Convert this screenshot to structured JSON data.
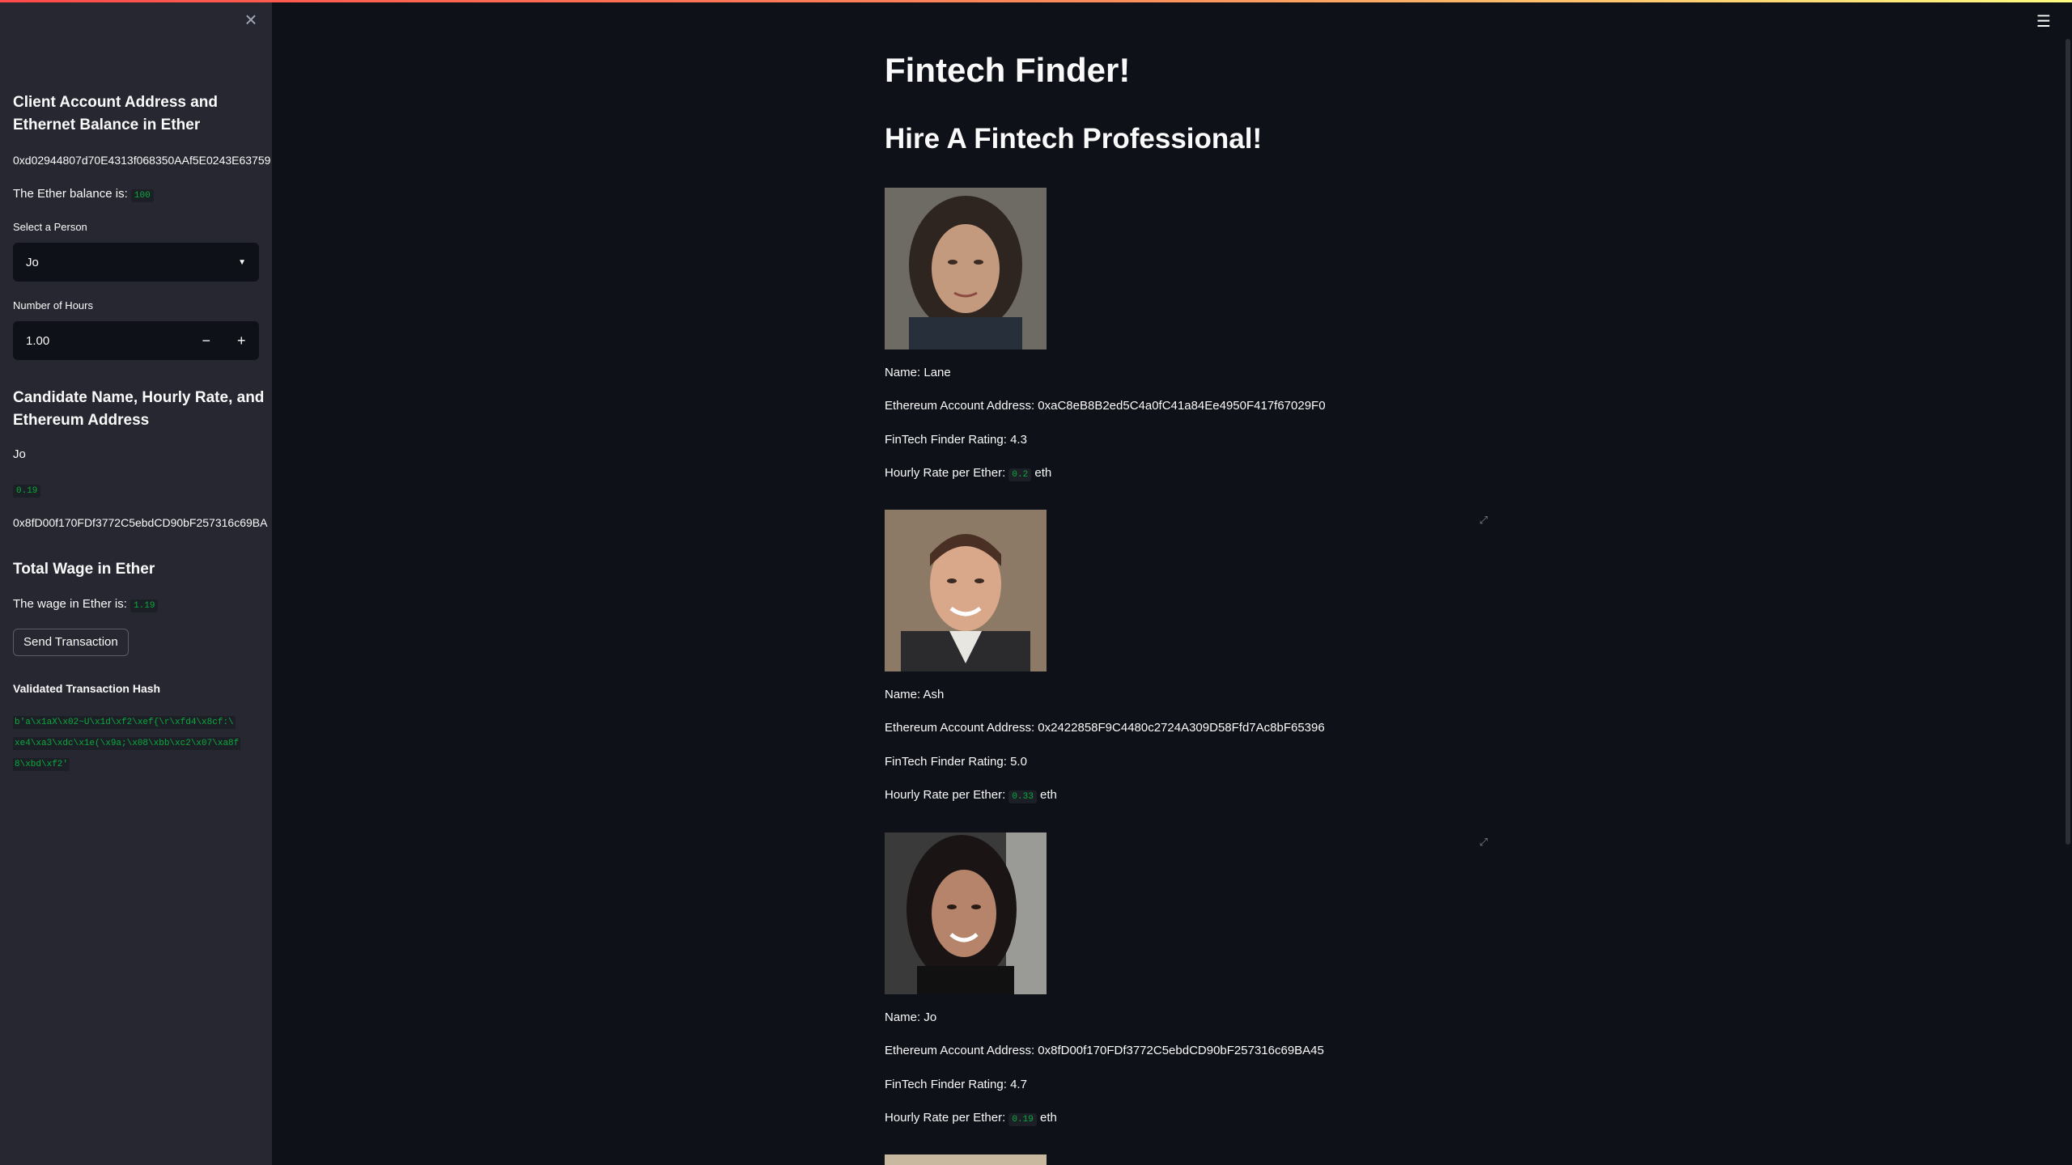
{
  "sidebar": {
    "close_icon": "×",
    "account_heading_line1": "Client Account Address and",
    "account_heading_line2": "Ethernet Balance in Ether",
    "account_address": "0xd02944807d70E4313f068350AAf5E0243E63759",
    "balance_label": "The Ether balance is:",
    "balance_value": "100",
    "select_label": "Select a Person",
    "select_value": "Jo",
    "hours_label": "Number of Hours",
    "hours_value": "1.00",
    "minus": "−",
    "plus": "+",
    "candidate_heading_line1": "Candidate Name, Hourly Rate, and",
    "candidate_heading_line2": "Ethereum Address",
    "candidate_name": "Jo",
    "candidate_rate": "0.19",
    "candidate_address": "0x8fD00f170FDf3772C5ebdCD90bF257316c69BA",
    "wage_heading": "Total Wage in Ether",
    "wage_label": "The wage in Ether is:",
    "wage_value": "1.19",
    "send_button": "Send Transaction",
    "hash_heading": "Validated Transaction Hash",
    "hash_line1": "b'a\\x1aX\\x02~U\\x1d\\xf2\\xef{\\r\\xfd4\\x8cf:\\",
    "hash_line2": "xe4\\xa3\\xdc\\x1e(\\x9a;\\x08\\xbb\\xc2\\x07\\xa8f",
    "hash_line3": "8\\xbd\\xf2'"
  },
  "main": {
    "hamburger_icon": "☰",
    "title": "Fintech Finder!",
    "subtitle": "Hire A Fintech Professional!",
    "candidates": [
      {
        "name": "Name: Lane",
        "address": "Ethereum Account Address: 0xaC8eB8B2ed5C4a0fC41a84Ee4950F417f67029F0",
        "rating": "FinTech Finder Rating: 4.3",
        "rate_label": "Hourly Rate per Ether:",
        "rate_value": "0.2",
        "rate_unit": "eth",
        "photo": "woman-portrait"
      },
      {
        "name": "Name: Ash",
        "address": "Ethereum Account Address: 0x2422858F9C4480c2724A309D58Ffd7Ac8bF65396",
        "rating": "FinTech Finder Rating: 5.0",
        "rate_label": "Hourly Rate per Ether:",
        "rate_value": "0.33",
        "rate_unit": "eth",
        "photo": "man-portrait"
      },
      {
        "name": "Name: Jo",
        "address": "Ethereum Account Address: 0x8fD00f170FDf3772C5ebdCD90bF257316c69BA45",
        "rating": "FinTech Finder Rating: 4.7",
        "rate_label": "Hourly Rate per Ether:",
        "rate_value": "0.19",
        "rate_unit": "eth",
        "photo": "woman-portrait"
      }
    ]
  }
}
